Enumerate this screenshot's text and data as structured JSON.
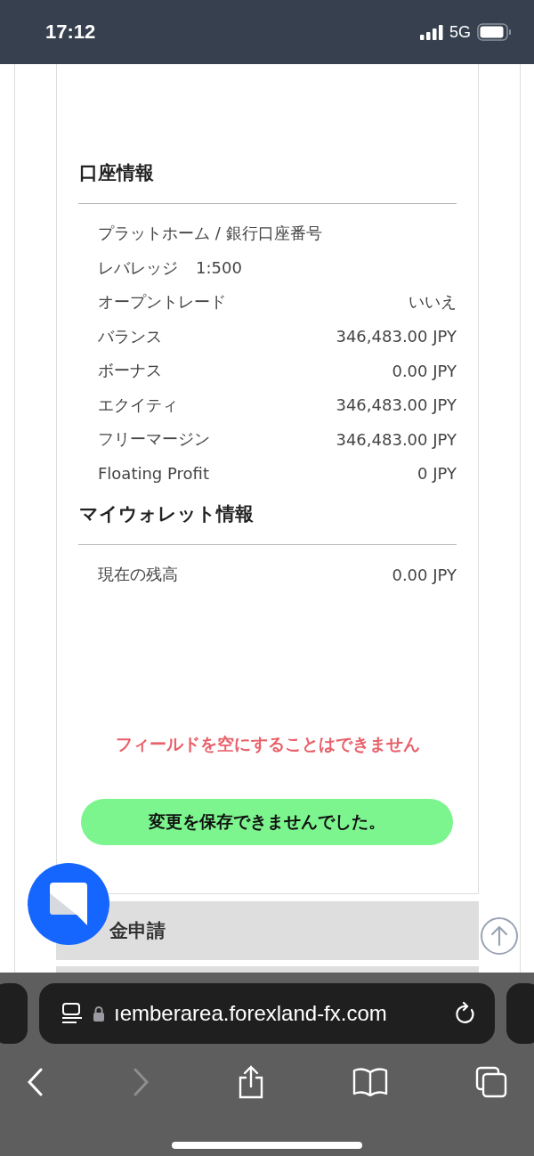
{
  "status_bar": {
    "time": "17:12",
    "network": "5G"
  },
  "sections": [
    {
      "title": "口座情報",
      "rows": [
        {
          "kind": "single",
          "label": "プラットホーム / 銀行口座番号"
        },
        {
          "kind": "inline",
          "label": "レバレッジ",
          "value": "1:500"
        },
        {
          "kind": "split",
          "label": "オープントレード",
          "value": "いいえ"
        },
        {
          "kind": "split",
          "label": "バランス",
          "value": "346,483.00 JPY"
        },
        {
          "kind": "split",
          "label": "ボーナス",
          "value": "0.00 JPY"
        },
        {
          "kind": "split",
          "label": "エクイティ",
          "value": "346,483.00 JPY"
        },
        {
          "kind": "split",
          "label": "フリーマージン",
          "value": "346,483.00 JPY"
        },
        {
          "kind": "split",
          "label": "Floating Profit",
          "value": "0 JPY"
        }
      ]
    },
    {
      "title": "マイウォレット情報",
      "rows": [
        {
          "kind": "split",
          "label": "現在の残高",
          "value": "0.00 JPY"
        }
      ]
    }
  ],
  "error_message": "フィールドを空にすることはできません",
  "save_result": "変更を保存できませんでした。",
  "next_section": {
    "title": "金申請"
  },
  "browser": {
    "url": "ıemberarea.forexland-fx.com"
  }
}
